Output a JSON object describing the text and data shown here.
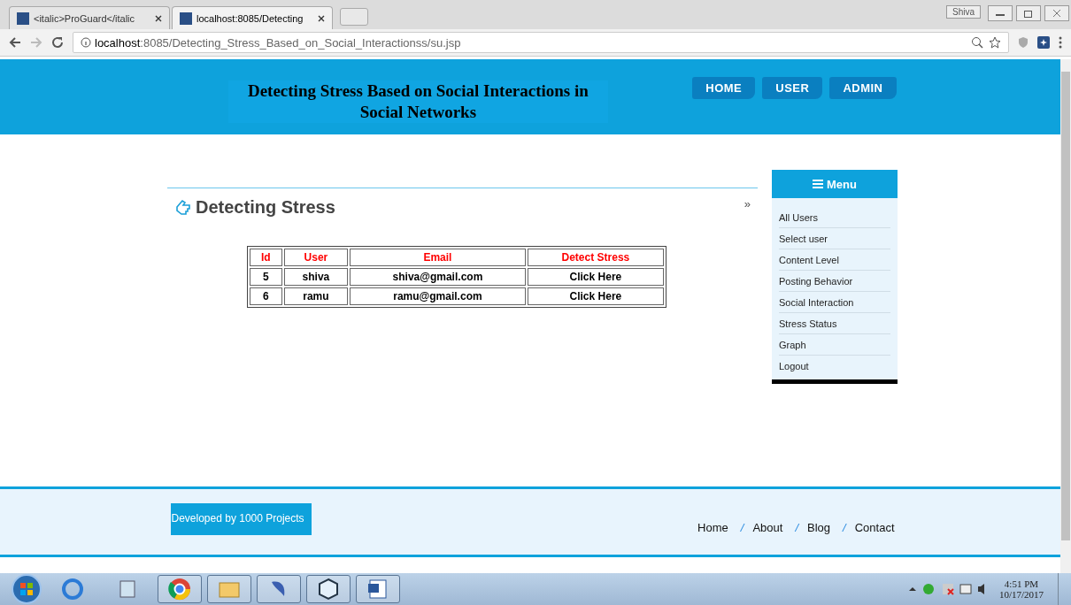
{
  "browser": {
    "tabs": [
      {
        "title": "<italic>ProGuard</italic",
        "selected": false
      },
      {
        "title": "localhost:8085/Detecting",
        "selected": true
      }
    ],
    "profile": "Shiva",
    "url_host": "localhost",
    "url_rest": ":8085/Detecting_Stress_Based_on_Social_Interactionss/su.jsp"
  },
  "header": {
    "title": "Detecting Stress Based on Social Interactions in Social Networks",
    "nav": [
      {
        "label": "HOME"
      },
      {
        "label": "USER"
      },
      {
        "label": "ADMIN"
      }
    ]
  },
  "content": {
    "heading": "Detecting Stress",
    "more": "»",
    "table": {
      "columns": [
        "Id",
        "User",
        "Email",
        "Detect Stress"
      ],
      "rows": [
        [
          "5",
          "shiva",
          "shiva@gmail.com",
          "Click Here"
        ],
        [
          "6",
          "ramu",
          "ramu@gmail.com",
          "Click Here"
        ]
      ]
    }
  },
  "menu": {
    "title": "Menu",
    "items": [
      "All Users",
      "Select user",
      "Content Level",
      "Posting Behavior",
      "Social Interaction",
      "Stress Status",
      "Graph",
      "Logout"
    ]
  },
  "footer": {
    "credit": "Developed by 1000 Projects",
    "links": [
      {
        "label": "Home"
      },
      {
        "separator": "/",
        "label": "About"
      },
      {
        "separator": "/",
        "label": "Blog"
      },
      {
        "separator": "/",
        "label": "Contact"
      }
    ]
  },
  "taskbar": {
    "time": "4:51 PM",
    "date": "10/17/2017"
  }
}
